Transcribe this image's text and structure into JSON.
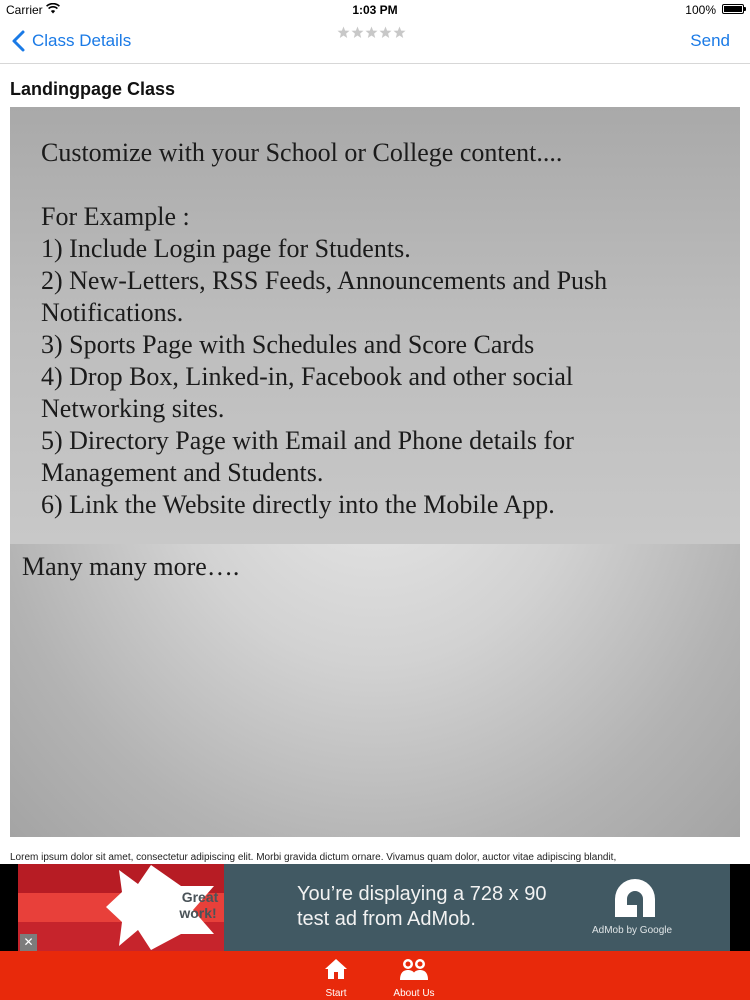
{
  "status_bar": {
    "carrier": "Carrier",
    "time": "1:03 PM",
    "battery": "100%"
  },
  "nav": {
    "back_label": "Class Details",
    "send_label": "Send",
    "rating_stars": 5,
    "rating_value": 0
  },
  "page": {
    "title": "Landingpage Class"
  },
  "content": {
    "lines": [
      "Customize with your School or College content....",
      "",
      "For Example :",
      "1) Include Login page for Students.",
      "2) New-Letters, RSS Feeds, Announcements and Push",
      "Notifications.",
      "3) Sports Page with Schedules and Score Cards",
      "4) Drop Box, Linked-in, Facebook and other social",
      "Networking sites.",
      "5) Directory Page with Email and Phone details for",
      "Management and Students.",
      "6) Link the Website directly into the Mobile App."
    ],
    "footer": "Many many more…."
  },
  "body_text": "Lorem ipsum dolor sit amet, consectetur adipiscing elit. Morbi gravida dictum ornare. Vivamus quam dolor, auctor vitae adipiscing blandit,",
  "ad": {
    "badge": [
      "Great",
      "work!"
    ],
    "line1": "You’re displaying a 728 x 90",
    "line2": "test ad from AdMob.",
    "attribution": "AdMob by Google",
    "close": "✕",
    "colors": {
      "panel": "#415963",
      "stripe_dark": "#b71c24",
      "stripe_mid": "#e8403a",
      "stripe_light": "#c6242c"
    }
  },
  "tabs": [
    {
      "label": "Start",
      "icon": "home-icon"
    },
    {
      "label": "About Us",
      "icon": "people-icon"
    }
  ],
  "colors": {
    "accent": "#1a7ae6",
    "tab_bar": "#e8290b"
  }
}
